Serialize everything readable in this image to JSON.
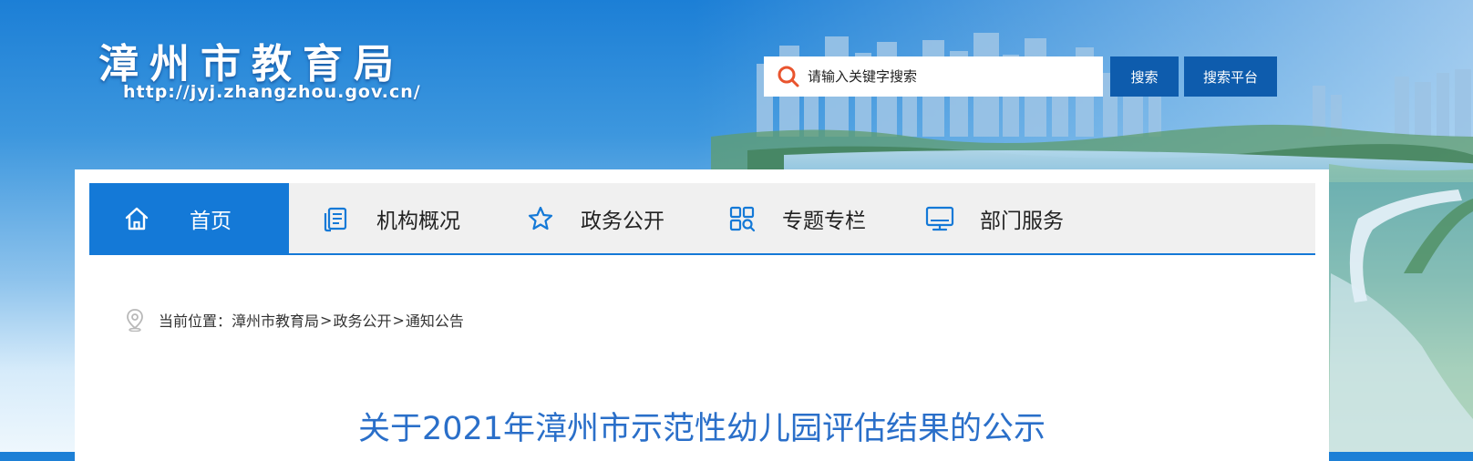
{
  "header": {
    "site_title": "漳州市教育局",
    "site_url": "http://jyj.zhangzhou.gov.cn/"
  },
  "search": {
    "placeholder": "请输入关键字搜索",
    "search_button": "搜索",
    "platform_button": "搜索平台"
  },
  "nav": {
    "items": [
      {
        "label": "首页",
        "icon": "home-icon",
        "active": true
      },
      {
        "label": "机构概况",
        "icon": "document-list-icon"
      },
      {
        "label": "政务公开",
        "icon": "star-icon"
      },
      {
        "label": "专题专栏",
        "icon": "grid-search-icon"
      },
      {
        "label": "部门服务",
        "icon": "monitor-icon"
      }
    ]
  },
  "breadcrumb": {
    "prefix": "当前位置：",
    "items": [
      "漳州市教育局",
      "政务公开",
      "通知公告"
    ],
    "separator": ">"
  },
  "article": {
    "title": "关于2021年漳州市示范性幼儿园评估结果的公示"
  },
  "colors": {
    "accent": "#1479d7",
    "button": "#0e5cad",
    "title": "#2a6fc9"
  }
}
